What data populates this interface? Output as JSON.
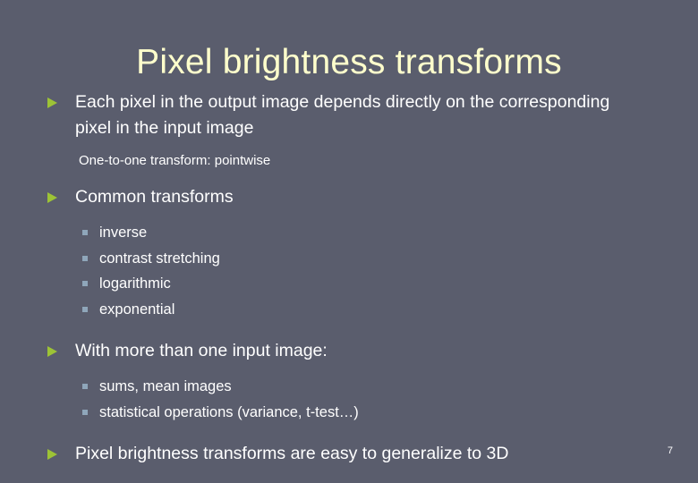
{
  "slide": {
    "title": "Pixel brightness transforms",
    "page_number": "7",
    "colors": {
      "background": "#5a5d6d",
      "title_text": "#ffffcc",
      "body_text": "#ffffff",
      "level1_marker": "#9dc336",
      "level2_marker": "#8fa6ba"
    },
    "content": {
      "bullet_1": {
        "text": "Each pixel in the output image depends directly on the corresponding pixel in the input image"
      },
      "note_1": {
        "text": "One-to-one transform: pointwise"
      },
      "bullet_2": {
        "text": "Common transforms"
      },
      "bullet_2_children": [
        {
          "text": "inverse"
        },
        {
          "text": "contrast stretching"
        },
        {
          "text": "logarithmic"
        },
        {
          "text": "exponential"
        }
      ],
      "bullet_3": {
        "text": "With more than one input image:"
      },
      "bullet_3_children": [
        {
          "text": "sums, mean images"
        },
        {
          "text": "statistical operations (variance, t-test…)"
        }
      ],
      "bullet_4": {
        "text": "Pixel brightness transforms are easy to generalize to 3D"
      }
    }
  }
}
